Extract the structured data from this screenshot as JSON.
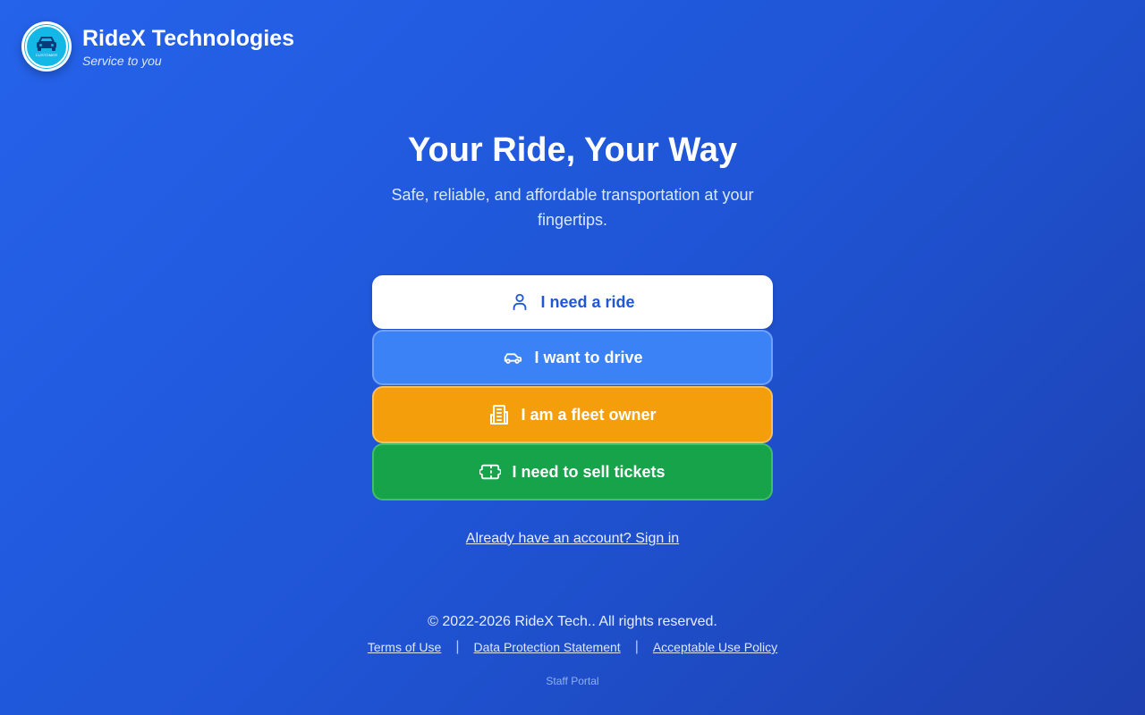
{
  "brand": {
    "name": "RideX Technologies",
    "tagline": "Service to you",
    "logo_caption": "CUSTOMER",
    "logo_icon": "car-icon"
  },
  "hero": {
    "title": "Your Ride, Your Way",
    "subtitle": "Safe, reliable, and affordable transportation at your fingertips."
  },
  "actions": [
    {
      "label": "I need a ride",
      "icon": "user-icon",
      "color": "#ffffff"
    },
    {
      "label": "I want to drive",
      "icon": "car-icon",
      "color": "#3b82f6"
    },
    {
      "label": "I am a fleet owner",
      "icon": "building-icon",
      "color": "#f59e0b"
    },
    {
      "label": "I need to sell tickets",
      "icon": "ticket-icon",
      "color": "#16a34a"
    }
  ],
  "signin": {
    "label": "Already have an account? Sign in"
  },
  "footer": {
    "copyright": "© 2022-2026 RideX Tech.. All rights reserved.",
    "links": [
      "Terms of Use",
      "Data Protection Statement",
      "Acceptable Use Policy"
    ],
    "staff_portal": "Staff Portal"
  },
  "colors": {
    "background": "#2563eb",
    "primary_text": "#2057d4"
  }
}
